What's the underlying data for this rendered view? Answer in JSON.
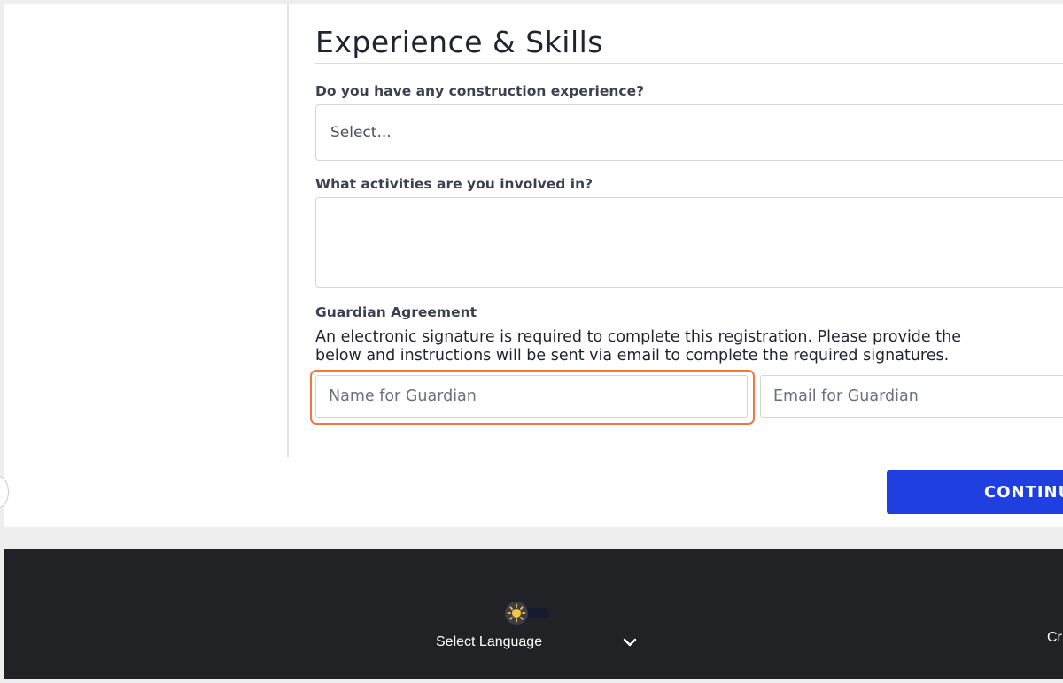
{
  "form": {
    "section_title": "Experience & Skills",
    "construction_question": "Do you have any construction experience?",
    "construction_select_value": "Select...",
    "activities_question": "What activities are you involved in?",
    "activities_value": "",
    "guardian_heading": "Guardian Agreement",
    "guardian_text_line1": "An electronic signature is required to complete this registration. Please provide the",
    "guardian_text_line2": "below and instructions will be sent via email to complete the required signatures.",
    "guardian_name_placeholder": "Name for Guardian",
    "guardian_email_placeholder": "Email for Guardian",
    "focused_field": "guardian_name"
  },
  "actions": {
    "continue_label": "CONTINUE"
  },
  "footer": {
    "language_label": "Select Language",
    "cut_text": "Cr",
    "theme_icon": "sun-icon"
  },
  "colors": {
    "primary_button": "#1f3fe0",
    "focus_ring": "#f07a3e",
    "footer_bg": "#212226",
    "sun": "#f5c542"
  }
}
